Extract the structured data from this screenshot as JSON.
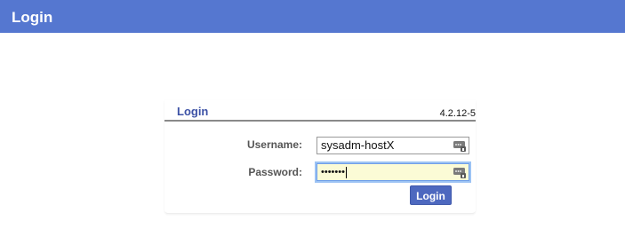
{
  "header": {
    "title": "Login"
  },
  "panel": {
    "title": "Login",
    "version": "4.2.12-5",
    "username": {
      "label": "Username:",
      "value": "sysadm-hostX"
    },
    "password": {
      "label": "Password:",
      "masked_value": "•••••••"
    },
    "submit_label": "Login"
  },
  "colors": {
    "header_bg": "#5577d0",
    "panel_title": "#3d52a6",
    "button_bg": "#4d68bf",
    "password_bg": "#fbfbd6",
    "focus_ring": "#9cc3f4"
  },
  "icons": {
    "username_field": "password-manager-key-icon",
    "password_field": "password-manager-key-icon"
  }
}
